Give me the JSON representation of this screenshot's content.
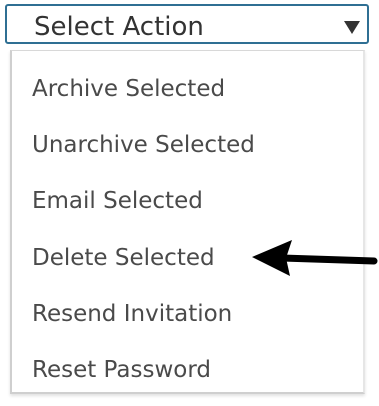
{
  "select": {
    "label": "Select Action",
    "caret_icon": "caret-down-icon"
  },
  "menu": {
    "items": [
      {
        "label": "Archive Selected"
      },
      {
        "label": "Unarchive Selected"
      },
      {
        "label": "Email Selected"
      },
      {
        "label": "Delete Selected"
      },
      {
        "label": "Resend Invitation"
      },
      {
        "label": "Reset Password"
      }
    ]
  },
  "annotation": {
    "arrow_icon": "left-arrow-icon",
    "arrow_color": "#000000"
  },
  "colors": {
    "select_border": "#2f6f93",
    "text": "#333333",
    "menu_text": "#4a4a4a"
  }
}
